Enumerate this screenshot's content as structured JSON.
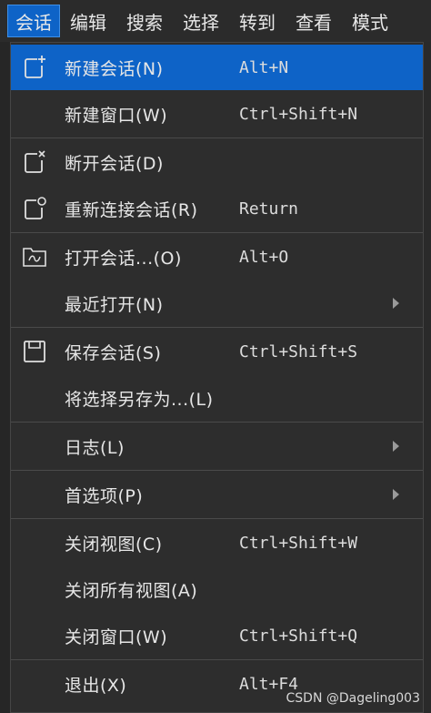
{
  "menubar": {
    "items": [
      "会话",
      "编辑",
      "搜索",
      "选择",
      "转到",
      "查看",
      "模式"
    ]
  },
  "menu": {
    "items": [
      {
        "label": "新建会话(N)",
        "shortcut": "Alt+N",
        "icon": "new-session-icon"
      },
      {
        "label": "新建窗口(W)",
        "shortcut": "Ctrl+Shift+N"
      },
      {
        "label": "断开会话(D)",
        "shortcut": "",
        "icon": "disconnect-icon"
      },
      {
        "label": "重新连接会话(R)",
        "shortcut": "Return",
        "icon": "reconnect-icon"
      },
      {
        "label": "打开会话...(O)",
        "shortcut": "Alt+O",
        "icon": "open-folder-icon"
      },
      {
        "label": "最近打开(N)",
        "shortcut": "",
        "submenu": true
      },
      {
        "label": "保存会话(S)",
        "shortcut": "Ctrl+Shift+S",
        "icon": "save-icon"
      },
      {
        "label": "将选择另存为...(L)",
        "shortcut": ""
      },
      {
        "label": "日志(L)",
        "shortcut": "",
        "submenu": true
      },
      {
        "label": "首选项(P)",
        "shortcut": "",
        "submenu": true
      },
      {
        "label": "关闭视图(C)",
        "shortcut": "Ctrl+Shift+W"
      },
      {
        "label": "关闭所有视图(A)",
        "shortcut": ""
      },
      {
        "label": "关闭窗口(W)",
        "shortcut": "Ctrl+Shift+Q"
      },
      {
        "label": "退出(X)",
        "shortcut": "Alt+F4"
      }
    ]
  },
  "watermark": "CSDN @Dageling003",
  "colors": {
    "accent": "#0e63c7",
    "menu_bg": "#2d2d2d",
    "separator": "#4a4a4a"
  }
}
